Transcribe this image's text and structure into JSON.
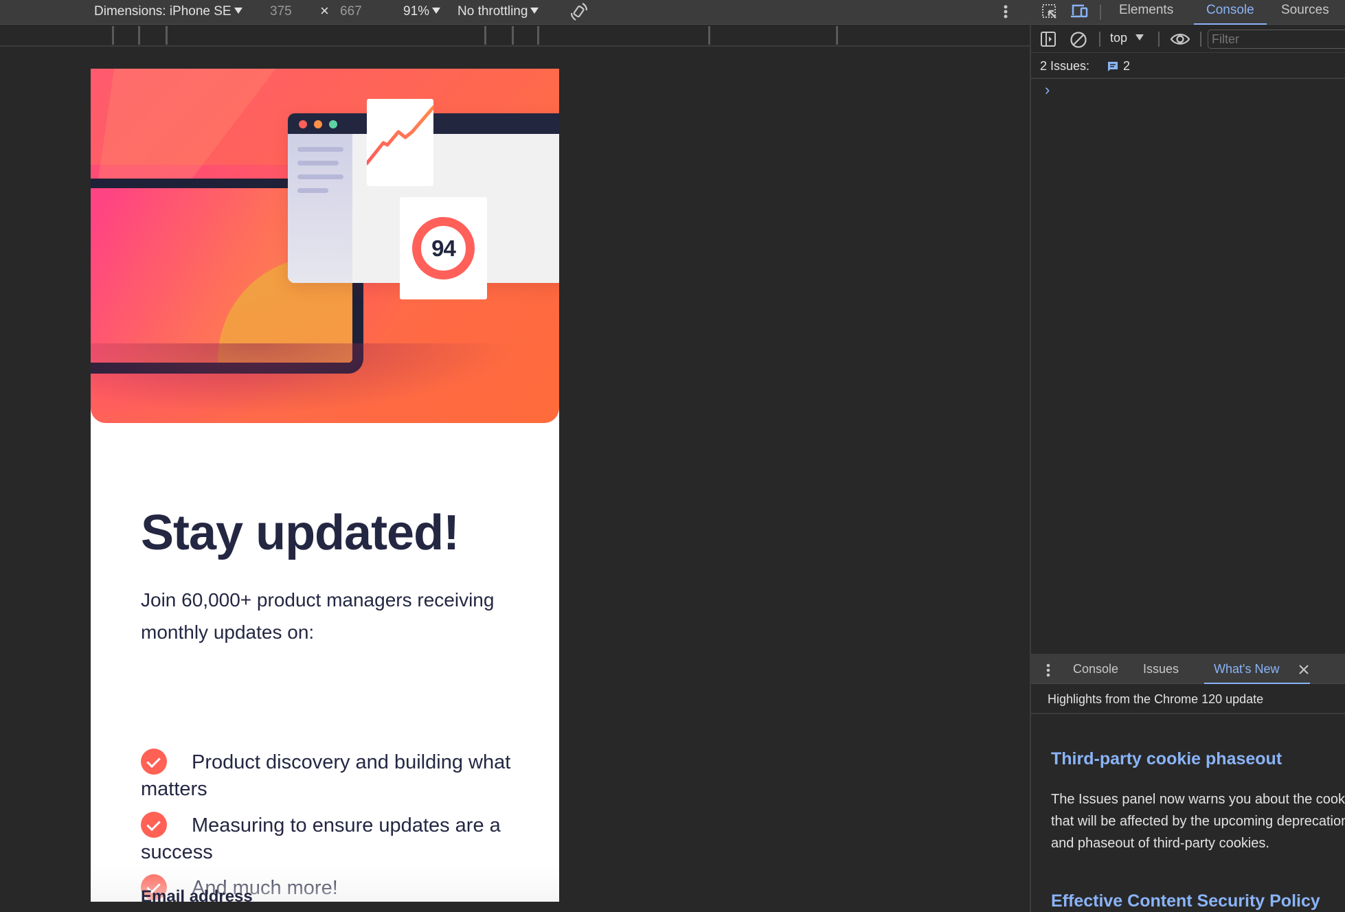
{
  "device_toolbar": {
    "dimensions_label": "Dimensions: iPhone SE",
    "width": "375",
    "times": "×",
    "height": "667",
    "zoom": "91%",
    "throttling": "No throttling"
  },
  "page": {
    "hero": {
      "score": "94",
      "colors": {
        "accent": "#ff6155",
        "dark": "#242742"
      }
    },
    "title": "Stay updated!",
    "intro": "Join 60,000+ product managers receiving monthly updates on:",
    "features": [
      "Product discovery and building what matters",
      "Measuring to ensure updates are a success",
      "And much more!"
    ],
    "email_label": "Email address"
  },
  "devtools": {
    "tabs": [
      "Elements",
      "Console",
      "Sources"
    ],
    "active_tab": "Console",
    "context": "top",
    "filter_placeholder": "Filter",
    "issues_label": "2 Issues:",
    "issues_count": "2",
    "prompt": "›",
    "drawer": {
      "tabs": [
        "Console",
        "Issues",
        "What's New"
      ],
      "active_tab": "What's New",
      "highlights": "Highlights from the Chrome 120 update",
      "articles": [
        {
          "title": "Third-party cookie phaseout",
          "body": "The Issues panel now warns you about the cookies that will be affected by the upcoming deprecation and phaseout of third-party cookies."
        },
        {
          "title": "Effective Content Security Policy",
          "body": ""
        }
      ]
    }
  }
}
